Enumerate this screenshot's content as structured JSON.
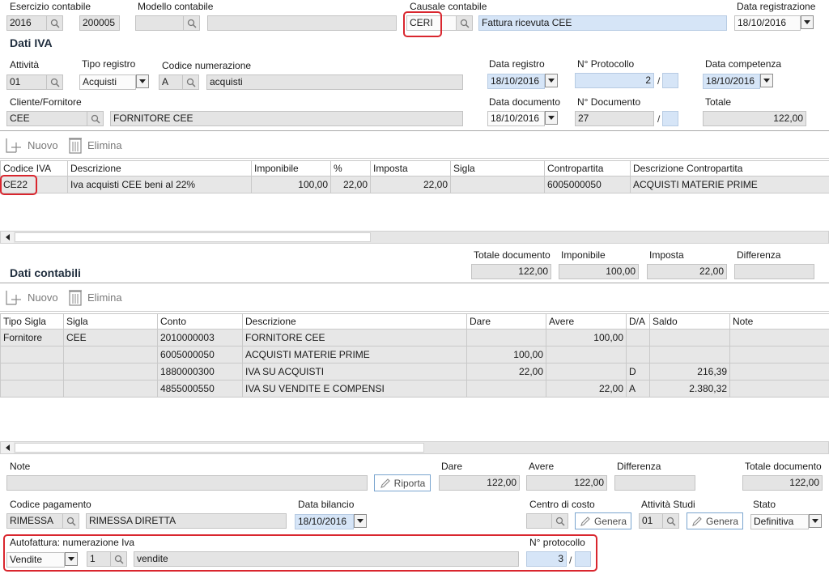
{
  "header": {
    "esercizio": {
      "label": "Esercizio contabile",
      "value": "2016",
      "value2": "200005"
    },
    "modello": {
      "label": "Modello contabile",
      "code": "",
      "desc": ""
    },
    "causale": {
      "label": "Causale contabile",
      "code": "CERI",
      "desc": "Fattura ricevuta CEE"
    },
    "data_registrazione": {
      "label": "Data registrazione",
      "value": "18/10/2016"
    }
  },
  "iva": {
    "title": "Dati IVA",
    "attivita": {
      "label": "Attività",
      "value": "01"
    },
    "tipo_registro": {
      "label": "Tipo registro",
      "value": "Acquisti"
    },
    "codice_numerazione": {
      "label": "Codice numerazione",
      "code": "A",
      "desc": "acquisti"
    },
    "data_registro": {
      "label": "Data registro",
      "value": "18/10/2016"
    },
    "protocollo": {
      "label": "N° Protocollo",
      "value": "2",
      "suffix": ""
    },
    "data_competenza": {
      "label": "Data competenza",
      "value": "18/10/2016"
    },
    "cliente_fornitore": {
      "label": "Cliente/Fornitore",
      "code": "CEE",
      "desc": "FORNITORE CEE"
    },
    "data_documento": {
      "label": "Data documento",
      "value": "18/10/2016"
    },
    "n_documento": {
      "label": "N° Documento",
      "value": "27",
      "suffix": ""
    },
    "totale": {
      "label": "Totale",
      "value": "122,00"
    },
    "toolbar": {
      "nuovo": "Nuovo",
      "elimina": "Elimina"
    },
    "columns": [
      "Codice IVA",
      "Descrizione",
      "Imponibile",
      "%",
      "Imposta",
      "Sigla",
      "Contropartita",
      "Descrizione Contropartita"
    ],
    "rows": [
      [
        "CE22",
        "Iva acquisti CEE beni al 22%",
        "100,00",
        "22,00",
        "22,00",
        "",
        "6005000050",
        "ACQUISTI MATERIE PRIME"
      ]
    ]
  },
  "totals": {
    "totale_documento": {
      "label": "Totale documento",
      "value": "122,00"
    },
    "imponibile": {
      "label": "Imponibile",
      "value": "100,00"
    },
    "imposta": {
      "label": "Imposta",
      "value": "22,00"
    },
    "differenza": {
      "label": "Differenza",
      "value": ""
    }
  },
  "contabili": {
    "title": "Dati contabili",
    "toolbar": {
      "nuovo": "Nuovo",
      "elimina": "Elimina"
    },
    "columns": [
      "Tipo Sigla",
      "Sigla",
      "Conto",
      "Descrizione",
      "Dare",
      "Avere",
      "D/A",
      "Saldo",
      "Note"
    ],
    "rows": [
      [
        "Fornitore",
        "CEE",
        "2010000003",
        "FORNITORE CEE",
        "",
        "100,00",
        "",
        "",
        ""
      ],
      [
        "",
        "",
        "6005000050",
        "ACQUISTI MATERIE PRIME",
        "100,00",
        "",
        "",
        "",
        ""
      ],
      [
        "",
        "",
        "1880000300",
        "IVA SU ACQUISTI",
        "22,00",
        "",
        "D",
        "216,39",
        ""
      ],
      [
        "",
        "",
        "4855000550",
        "IVA SU VENDITE E COMPENSI",
        "",
        "22,00",
        "A",
        "2.380,32",
        ""
      ]
    ]
  },
  "footer": {
    "note": {
      "label": "Note",
      "value": ""
    },
    "riporta": "Riporta",
    "dare": {
      "label": "Dare",
      "value": "122,00"
    },
    "avere": {
      "label": "Avere",
      "value": "122,00"
    },
    "differenza": {
      "label": "Differenza",
      "value": ""
    },
    "totale_documento": {
      "label": "Totale documento",
      "value": "122,00"
    },
    "codice_pagamento": {
      "label": "Codice pagamento",
      "code": "RIMESSA",
      "desc": "RIMESSA DIRETTA"
    },
    "data_bilancio": {
      "label": "Data bilancio",
      "value": "18/10/2016"
    },
    "centro_costo": {
      "label": "Centro di costo",
      "value": "",
      "genera": "Genera"
    },
    "attivita_studi": {
      "label": "Attività Studi",
      "value": "01",
      "genera": "Genera"
    },
    "stato": {
      "label": "Stato",
      "value": "Definitiva"
    },
    "autofattura": {
      "label": "Autofattura: numerazione Iva",
      "tipo": "Vendite",
      "code": "1",
      "desc": "vendite"
    },
    "protocollo": {
      "label": "N° protocollo",
      "value": "3",
      "suffix": ""
    }
  },
  "colors": {
    "highlight": "#d9262e",
    "field": "#e4e4e4",
    "field_blue": "#d6e5f7"
  }
}
